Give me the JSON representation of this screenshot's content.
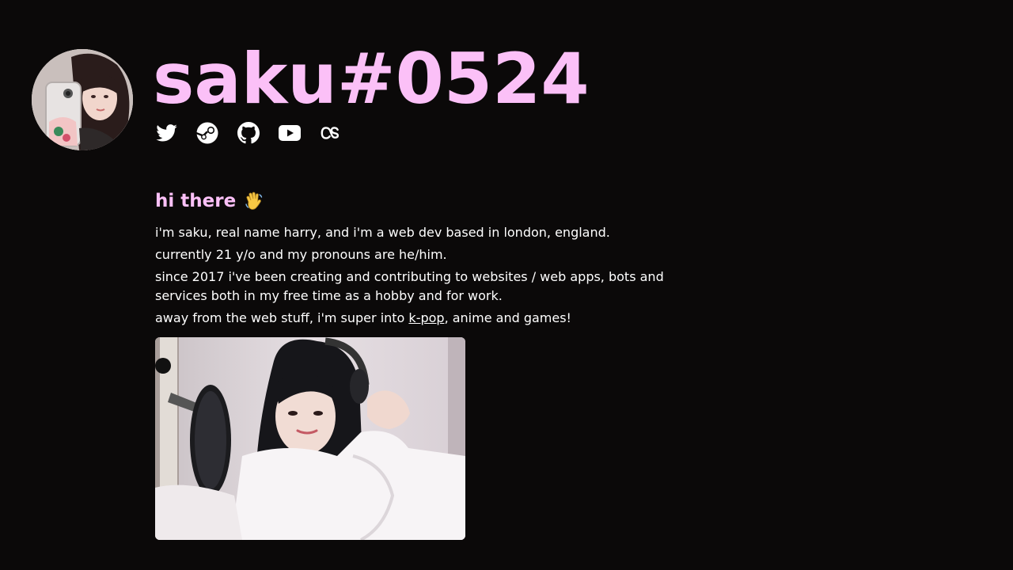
{
  "profile": {
    "handle": "saku#0524",
    "avatar_icon": "profile-photo",
    "accent_color": "#fbc0f7",
    "background_color": "#0b0909"
  },
  "socials": [
    {
      "name": "Twitter",
      "icon": "twitter-icon"
    },
    {
      "name": "Steam",
      "icon": "steam-icon"
    },
    {
      "name": "GitHub",
      "icon": "github-icon"
    },
    {
      "name": "YouTube",
      "icon": "youtube-icon"
    },
    {
      "name": "Last.fm",
      "icon": "lastfm-icon"
    }
  ],
  "about": {
    "heading": "hi there",
    "heading_emoji": "waving-hand-icon",
    "line1": "i'm saku, real name harry, and i'm a web dev based in london, england.",
    "line2": "currently 21 y/o and my pronouns are he/him.",
    "line3": "since 2017 i've been creating and contributing to websites / web apps, bots and services both in my free time as a hobby and for work.",
    "line4_prefix": "away from the web stuff, i'm super into ",
    "line4_link": "k-pop",
    "line4_suffix": ", anime and games!"
  },
  "media": {
    "photo_icon": "kpop-photo"
  }
}
